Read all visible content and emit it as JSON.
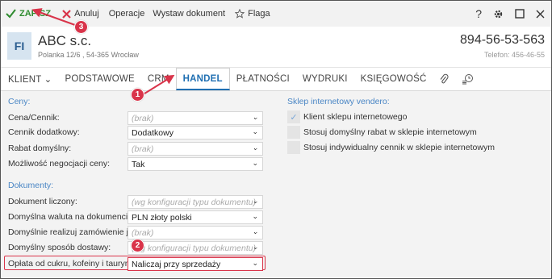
{
  "toolbar": {
    "save_label": "ZAPISZ",
    "cancel_label": "Anuluj",
    "operations_label": "Operacje",
    "issue_doc_label": "Wystaw dokument",
    "flag_label": "Flaga",
    "help_glyph": "?",
    "settings_icon": "gear-icon",
    "maximize_icon": "square-icon",
    "close_icon": "close-icon"
  },
  "header": {
    "avatar_initials": "FI",
    "company_name": "ABC s.c.",
    "address": "Polanka  12/6 , 54-365 Wrocław",
    "nip": "894-56-53-563",
    "phone": "Telefon: 456-46-55"
  },
  "tabs": [
    {
      "label": "KLIENT ⌄"
    },
    {
      "label": "PODSTAWOWE"
    },
    {
      "label": "CRM"
    },
    {
      "label": "HANDEL",
      "active": true
    },
    {
      "label": "PŁATNOŚCI"
    },
    {
      "label": "WYDRUKI"
    },
    {
      "label": "KSIĘGOWOŚĆ"
    }
  ],
  "prices": {
    "title": "Ceny:",
    "rows": [
      {
        "label": "Cena/Cennik:",
        "value": "(brak)"
      },
      {
        "label": "Cennik dodatkowy:",
        "value": "Dodatkowy"
      },
      {
        "label": "Rabat domyślny:",
        "value": "(brak)"
      },
      {
        "label": "Możliwość negocjacji ceny:",
        "value": "Tak"
      }
    ]
  },
  "documents": {
    "title": "Dokumenty:",
    "rows": [
      {
        "label": "Dokument liczony:",
        "value": "(wg konfiguracji typu dokumentu)"
      },
      {
        "label": "Domyślna waluta na dokumencie:",
        "value": "PLN  złoty polski"
      },
      {
        "label": "Domyślnie realizuj zamówienie jako:",
        "value": "(brak)"
      },
      {
        "label": "Domyślny sposób dostawy:",
        "value": "(wg konfiguracji typu dokumentu)"
      },
      {
        "label": "Opłata od cukru, kofeiny i tauryny:",
        "value": "Naliczaj przy sprzedaży"
      }
    ]
  },
  "shop": {
    "title": "Sklep internetowy vendero:",
    "options": [
      {
        "label": "Klient sklepu internetowego",
        "checked": true
      },
      {
        "label": "Stosuj domyślny rabat w sklepie internetowym",
        "checked": false
      },
      {
        "label": "Stosuj indywidualny cennik w sklepie internetowym",
        "checked": false
      }
    ]
  },
  "annotations": [
    "1",
    "2",
    "3"
  ],
  "colors": {
    "accent": "#1f6fb2",
    "save": "#2e8b2e",
    "annotation": "#d9344a",
    "section_title": "#4a86c5"
  }
}
